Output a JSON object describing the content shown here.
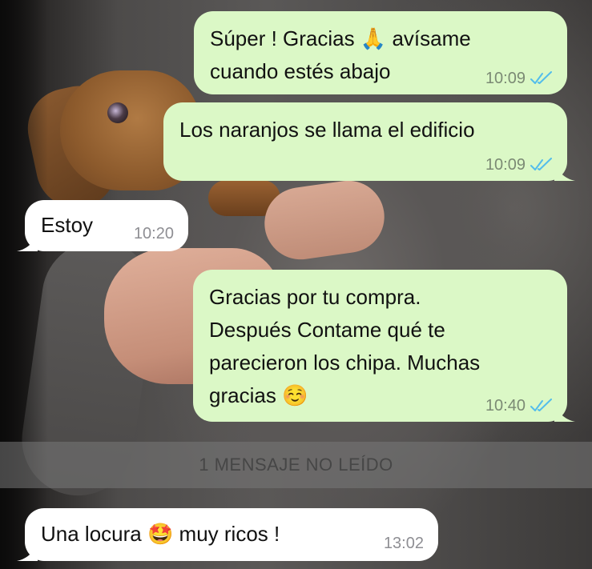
{
  "messages": [
    {
      "direction": "outgoing",
      "lines": [
        "Súper ! Gracias 🙏 avísame",
        "cuando estés abajo"
      ],
      "time": "10:09",
      "status": "read"
    },
    {
      "direction": "outgoing",
      "lines": [
        "Los naranjos se llama el edificio"
      ],
      "time": "10:09",
      "status": "read"
    },
    {
      "direction": "incoming",
      "lines": [
        "Estoy"
      ],
      "time": "10:20"
    },
    {
      "direction": "outgoing",
      "lines": [
        "Gracias por tu compra.",
        "Después Contame qué te",
        "parecieron los chipa. Muchas",
        "gracias ☺️"
      ],
      "time": "10:40",
      "status": "read"
    },
    {
      "direction": "incoming",
      "lines": [
        "Una locura 🤩 muy ricos !"
      ],
      "time": "13:02"
    }
  ],
  "unread_banner": "1 MENSAJE NO LEÍDO",
  "colors": {
    "outgoing_bubble": "#dbf8c6",
    "incoming_bubble": "#ffffff",
    "read_ticks": "#53bdeb"
  },
  "icons": {
    "read_status": "double-check-icon",
    "bubble_tail": "bubble-tail-icon"
  }
}
